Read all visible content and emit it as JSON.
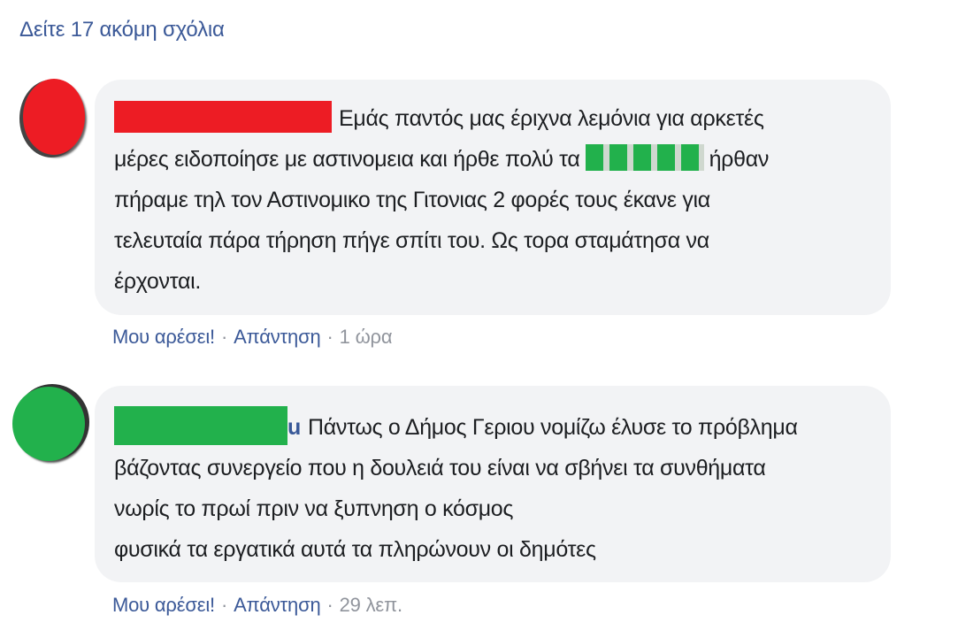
{
  "more_comments_link": "Δείτε 17 ακόμη σχόλια",
  "comments": [
    {
      "avatar_color": "#ed1c24",
      "text_part1": "Εμάς παντός μας έριχνα λεμόνια για αρκετές",
      "text_part2": "μέρες ειδοποίησε με αστινομεια και ήρθε πολύ τα",
      "text_part3": "ήρθαν",
      "text_line3": "πήραμε τηλ τον Αστινομικο της Γιτονιας 2 φορές τους έκανε για",
      "text_line4": "τελευταία πάρα τήρηση πήγε σπίτι του. Ως τορα σταμάτησα να",
      "text_line5": "έρχονται.",
      "like_label": "Μου αρέσει!",
      "reply_label": "Απάντηση",
      "time": "1 ώρα"
    },
    {
      "avatar_color": "#22b14c",
      "name_suffix": "u",
      "text_line1": "Πάντως ο Δήμος Γεριου νομίζω έλυσε το πρόβλημα",
      "text_line2": "βάζοντας συνεργείο που η δουλειά του είναι να σβήνει τα συνθήματα",
      "text_line3": "νωρίς το πρωί πριν να ξυπνηση ο κόσμος",
      "text_line4": "φυσικά τα εργατικά αυτά τα πληρώνουν οι δημότες",
      "like_label": "Μου αρέσει!",
      "reply_label": "Απάντηση",
      "time": "29 λεπ."
    }
  ],
  "separator": "·"
}
